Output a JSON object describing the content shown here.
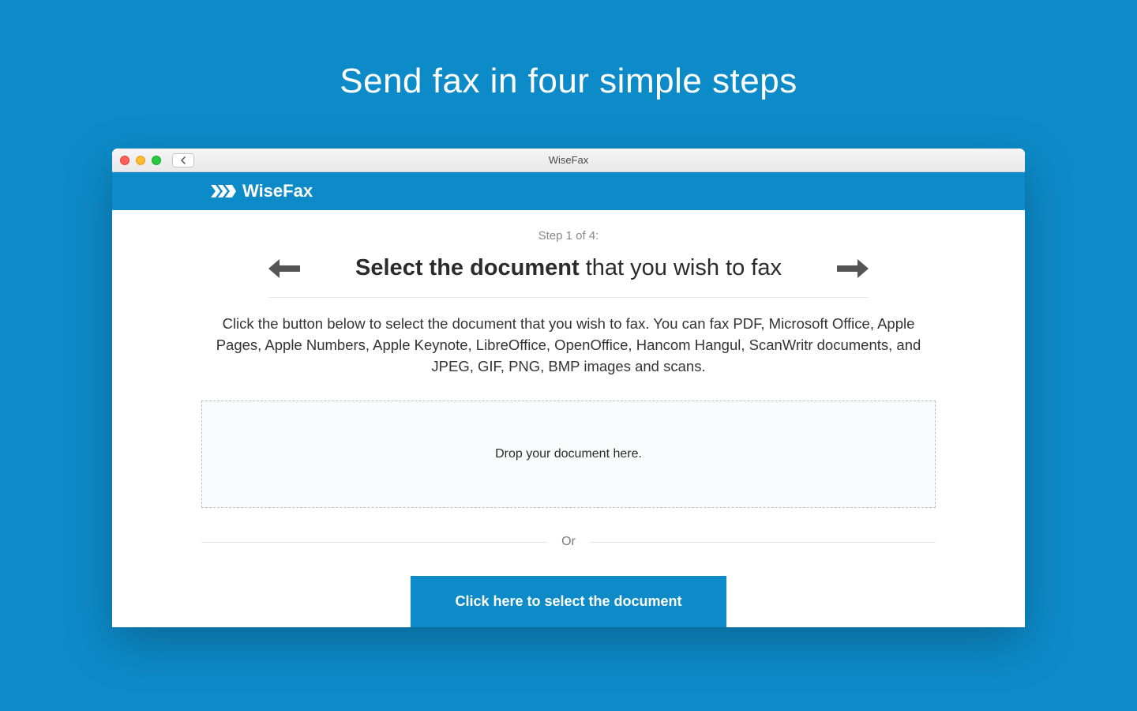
{
  "page": {
    "heading": "Send fax in four simple steps"
  },
  "window": {
    "title": "WiseFax"
  },
  "header": {
    "brand": "WiseFax"
  },
  "step": {
    "label": "Step 1 of 4:",
    "title_bold": "Select the document",
    "title_rest": " that you wish to fax"
  },
  "instructions": "Click the button below to select the document that you wish to fax. You can fax PDF, Microsoft Office, Apple Pages, Apple Numbers, Apple Keynote, LibreOffice, OpenOffice, Hancom Hangul, ScanWritr documents, and JPEG, GIF, PNG, BMP images and scans.",
  "dropzone": {
    "text": "Drop your document here."
  },
  "divider": {
    "text": "Or"
  },
  "button": {
    "select_document": "Click here to select the document"
  }
}
